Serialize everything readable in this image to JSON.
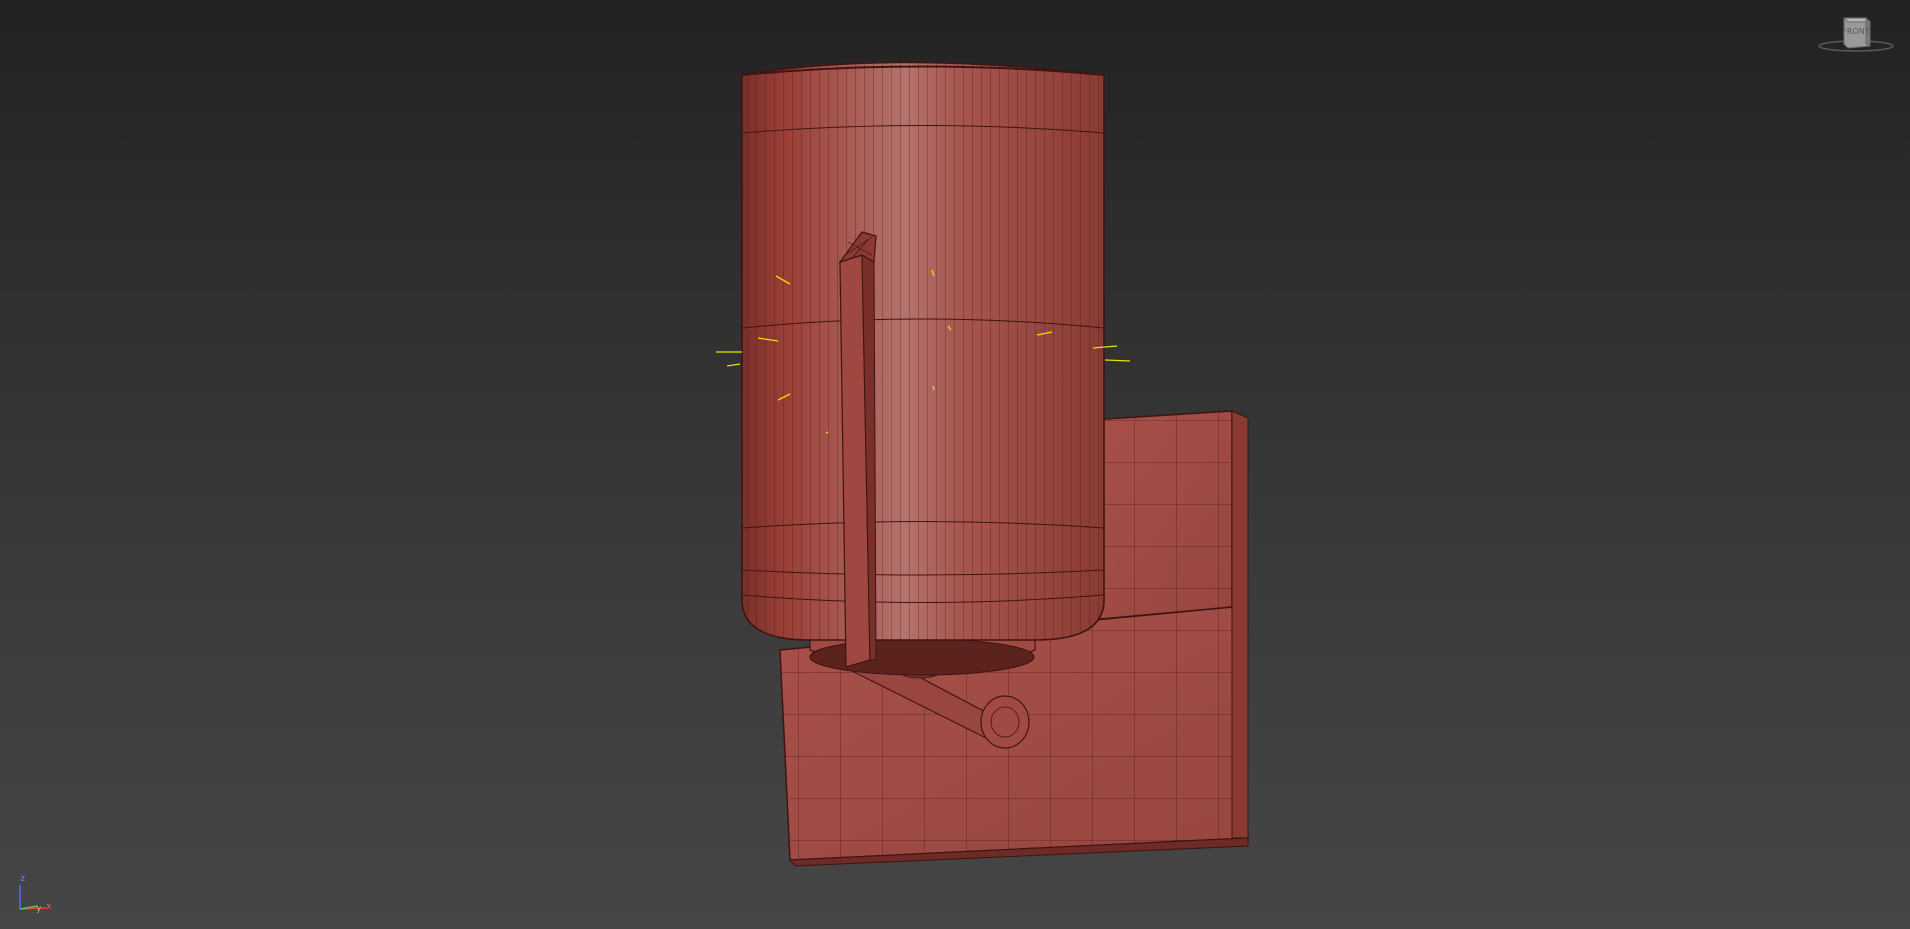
{
  "viewport": {
    "background_top": "#222222",
    "background_bottom": "#464646",
    "mesh_color": "#a8504a",
    "wire_color": "#3e1512",
    "light_helper_color": "#e8e000"
  },
  "viewcube": {
    "label": "FRONT",
    "icon": "viewcube-icon"
  },
  "axis_gizmo": {
    "z_label": "z",
    "x_label": "x",
    "y_label": "y",
    "z_color": "#5a68ff",
    "x_color": "#ff3a2a",
    "y_color": "#5ac34a"
  }
}
